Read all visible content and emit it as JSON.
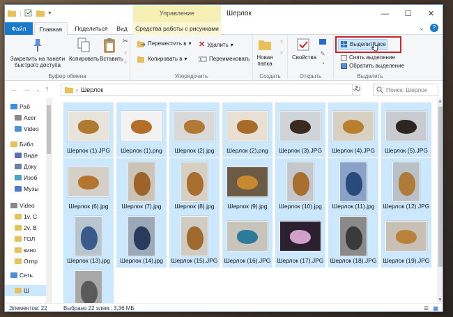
{
  "window": {
    "title": "Шерлок",
    "context_tab_header": "Управление",
    "controls": [
      "—",
      "☐",
      "✕"
    ]
  },
  "tabs": [
    {
      "label": "Файл"
    },
    {
      "label": "Главная"
    },
    {
      "label": "Поделиться"
    },
    {
      "label": "Вид"
    },
    {
      "label": "Средства работы с рисунками"
    }
  ],
  "ribbon": {
    "clipboard": {
      "group_label": "Буфер обмена",
      "pin_label": "Закрепить на панели быстрого доступа",
      "copy_label": "Копировать",
      "paste_label": "Вставить"
    },
    "organize": {
      "group_label": "Упорядочить",
      "move_label": "Переместить в",
      "copy_to_label": "Копировать в",
      "delete_label": "Удалить",
      "rename_label": "Переименовать"
    },
    "create": {
      "group_label": "Создать",
      "new_folder_label": "Новая папка"
    },
    "open": {
      "group_label": "Открыть",
      "properties_label": "Свойства"
    },
    "select": {
      "group_label": "Выделить",
      "select_all_label": "Выделить все",
      "deselect_label": "Снять выделение",
      "invert_label": "Обратить выделение"
    }
  },
  "address": {
    "path": "Шерлок",
    "search_placeholder": "Поиск: Шерлок"
  },
  "nav": {
    "items": [
      {
        "label": "Раб",
        "icon": "desktop-icon",
        "color": "#3b8de0"
      },
      {
        "label": "Acer",
        "icon": "drive-icon",
        "color": "#888888"
      },
      {
        "label": "Video",
        "icon": "video-folder-icon",
        "color": "#4a90d9"
      },
      {
        "label": "Библ",
        "icon": "library-icon",
        "color": "#e8c15a"
      },
      {
        "label": "Виде",
        "icon": "video-icon",
        "color": "#5b6fb8"
      },
      {
        "label": "Доку",
        "icon": "documents-icon",
        "color": "#6c7fa8"
      },
      {
        "label": "Изоб",
        "icon": "pictures-icon",
        "color": "#4aa3c8"
      },
      {
        "label": "Музы",
        "icon": "music-icon",
        "color": "#4a7ac8"
      },
      {
        "label": "Video",
        "icon": "drive-icon",
        "color": "#888888"
      },
      {
        "label": "1v. C",
        "icon": "folder-icon",
        "color": "#e8c15a"
      },
      {
        "label": "2v. B",
        "icon": "folder-icon",
        "color": "#e8c15a"
      },
      {
        "label": "ГОЛ",
        "icon": "folder-icon",
        "color": "#e8c15a"
      },
      {
        "label": "кино",
        "icon": "folder-icon",
        "color": "#e8c15a"
      },
      {
        "label": "Отпр",
        "icon": "folder-icon",
        "color": "#e8c15a"
      },
      {
        "label": "Сеть",
        "icon": "network-icon",
        "color": "#4a90d9"
      },
      {
        "label": "Ш",
        "icon": "folder-icon",
        "color": "#e8c15a"
      }
    ]
  },
  "files": [
    {
      "name": "Шерлок (1).JPG",
      "orient": "land",
      "bg": "#e8e4dc",
      "dog": "#b07a30"
    },
    {
      "name": "Шерлок (1).png",
      "orient": "land",
      "bg": "#f2f2f2",
      "dog": "#b36e28"
    },
    {
      "name": "Шерлок (2).jpg",
      "orient": "land",
      "bg": "#d9d9d9",
      "dog": "#b07a34"
    },
    {
      "name": "Шерлок (2).png",
      "orient": "land",
      "bg": "#e8e0d2",
      "dog": "#a86c2a"
    },
    {
      "name": "Шерлок (3).JPG",
      "orient": "land",
      "bg": "#cfd4d8",
      "dog": "#3a2a20"
    },
    {
      "name": "Шерлок (4).JPG",
      "orient": "land",
      "bg": "#d8d0c2",
      "dog": "#b8802e"
    },
    {
      "name": "Шерлок (5).JPG",
      "orient": "land",
      "bg": "#c8ccd0",
      "dog": "#2e2420"
    },
    {
      "name": "Шерлок (6).jpg",
      "orient": "land",
      "bg": "#d4d0c8",
      "dog": "#b47430"
    },
    {
      "name": "Шерлок (7).jpg",
      "orient": "port",
      "bg": "#cbc3b6",
      "dog": "#9c6428"
    },
    {
      "name": "Шерлок (8).jpg",
      "orient": "port",
      "bg": "#d6d0c4",
      "dog": "#a86e2e"
    },
    {
      "name": "Шерлок (9).jpg",
      "orient": "land",
      "bg": "#6b5a44",
      "dog": "#c88a30"
    },
    {
      "name": "Шерлок (10).jpg",
      "orient": "port",
      "bg": "#c4c8cc",
      "dog": "#a87030"
    },
    {
      "name": "Шерлок (11).jpg",
      "orient": "port",
      "bg": "#8aa2c8",
      "dog": "#2a4a7a"
    },
    {
      "name": "Шерлок (12).JPG",
      "orient": "port",
      "bg": "#b8c0c8",
      "dog": "#b07a38"
    },
    {
      "name": "Шерлок (13).jpg",
      "orient": "port",
      "bg": "#b8c4d0",
      "dog": "#3a5a8a"
    },
    {
      "name": "Шерлок (14).jpg",
      "orient": "port",
      "bg": "#9aa8b8",
      "dog": "#2a3a5a"
    },
    {
      "name": "Шерлок (15).JPG",
      "orient": "port",
      "bg": "#d0ccc4",
      "dog": "#a06a2e"
    },
    {
      "name": "Шерлок (16).JPG",
      "orient": "land",
      "bg": "#c8c4bc",
      "dog": "#2e7a9a"
    },
    {
      "name": "Шерлок (17).JPG",
      "orient": "land",
      "bg": "#2a2030",
      "dog": "#d0a0c8"
    },
    {
      "name": "Шерлок (18).JPG",
      "orient": "port",
      "bg": "#8a8a8a",
      "dog": "#3a3a3a"
    },
    {
      "name": "Шерлок (19).JPG",
      "orient": "land",
      "bg": "#c8c0b4",
      "dog": "#b8823a"
    },
    {
      "name": "",
      "orient": "port",
      "bg": "#a8a8a8",
      "dog": "#5a5a5a"
    }
  ],
  "status": {
    "items_count": "Элементов: 22",
    "selected": "Выбрано 22 элем.: 3,36 МБ"
  },
  "colors": {
    "accent": "#1979ca",
    "selection": "#cce8ff",
    "highlight_frame": "#d0202a"
  }
}
